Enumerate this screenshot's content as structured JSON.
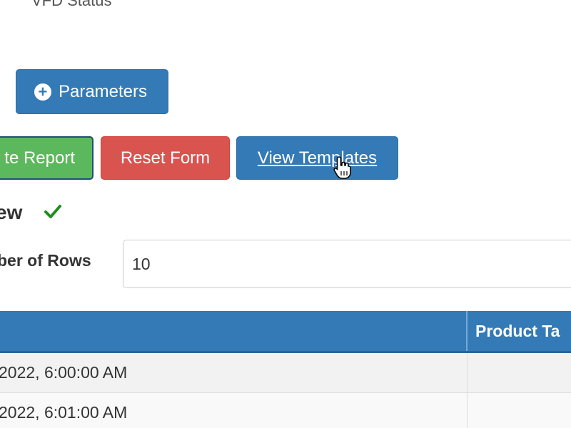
{
  "header": {
    "status_label": "VFD Status"
  },
  "toolbar": {
    "parameters_label": "Parameters",
    "generate_report_label": "te Report",
    "reset_form_label": "Reset Form",
    "view_templates_label": "View Templates"
  },
  "preview": {
    "title": "ew",
    "rows_label": "ber of Rows",
    "rows_value": "10"
  },
  "table": {
    "headers": [
      "Product Ta"
    ],
    "rows": [
      {
        "timestamp": "2022, 6:00:00 AM",
        "product_tag": ""
      },
      {
        "timestamp": "2022, 6:01:00 AM",
        "product_tag": ""
      }
    ]
  },
  "colors": {
    "primary": "#337ab7",
    "success": "#5cb85c",
    "danger": "#d9534f",
    "check": "#1e8e1e"
  },
  "icons": {
    "parameters_icon": "plus-circle-icon",
    "status_icon": "checkmark-icon",
    "cursor_icon": "hand-pointer-icon"
  }
}
